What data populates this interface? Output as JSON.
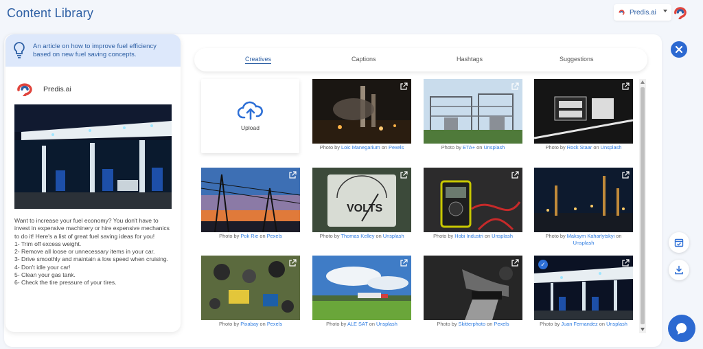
{
  "header": {
    "title": "Content Library"
  },
  "account": {
    "name": "Predis.ai"
  },
  "sidebar": {
    "prompt": "An article on how to improve fuel efficiency based on new fuel saving concepts.",
    "brand_name": "Predis.ai",
    "description": "Want to increase your fuel economy? You don't have to invest in expensive machinery or hire expensive mechanics to do it! Here's a list of great fuel saving ideas for you!\n1- Trim off excess weight.\n2- Remove all loose or unnecessary items in your car.\n3- Drive smoothly and maintain a low speed when cruising.\n4- Don't idle your car!\n5- Clean your gas tank.\n6- Check the tire pressure of your tires."
  },
  "tabs": [
    {
      "label": "Creatives",
      "active": true
    },
    {
      "label": "Captions",
      "active": false
    },
    {
      "label": "Hashtags",
      "active": false
    },
    {
      "label": "Suggestions",
      "active": false
    }
  ],
  "upload": {
    "label": "Upload"
  },
  "photos": [
    {
      "author": "Loic Manegarium",
      "source": "Pexels",
      "icon": "external-link-icon"
    },
    {
      "author": "ETA+",
      "source": "Unsplash",
      "icon": "external-link-icon"
    },
    {
      "author": "Rock Staar",
      "source": "Unsplash",
      "icon": "external-link-icon"
    },
    {
      "author": "Pok Rie",
      "source": "Pexels",
      "icon": "external-link-icon"
    },
    {
      "author": "Thomas Kelley",
      "source": "Unsplash",
      "icon": "external-link-icon"
    },
    {
      "author": "Hobi Industri",
      "source": "Unsplash",
      "icon": "external-link-icon"
    },
    {
      "author": "Maksym Kaharlytskyi",
      "source": "Unsplash",
      "icon": "external-link-icon"
    },
    {
      "author": "Pixabay",
      "source": "Pexels",
      "icon": "external-link-icon"
    },
    {
      "author": "ALE SAT",
      "source": "Unsplash",
      "icon": "external-link-icon"
    },
    {
      "author": "Skitterphoto",
      "source": "Pexels",
      "icon": "external-link-icon"
    },
    {
      "author": "Juan Fernandez",
      "source": "Unsplash",
      "icon": "external-link-icon",
      "selected": true
    }
  ],
  "caption": {
    "prefix": "Photo by",
    "joiner": "on"
  },
  "colors": {
    "accent": "#2d5fa4",
    "link": "#2d7be0",
    "button": "#2c69d1",
    "prompt_bg": "#dde8fb"
  }
}
